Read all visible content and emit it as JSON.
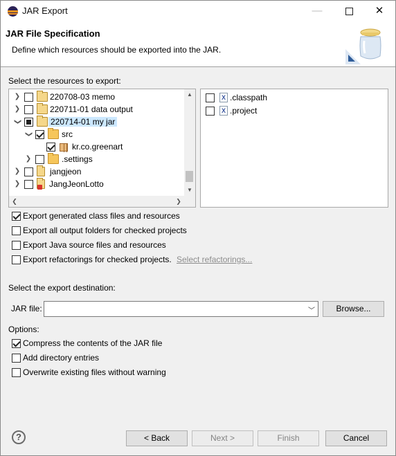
{
  "window": {
    "title": "JAR Export"
  },
  "banner": {
    "title": "JAR File Specification",
    "description": "Define which resources should be exported into the JAR."
  },
  "resources": {
    "label": "Select the resources to export:",
    "tree": [
      {
        "label": "220708-03 memo",
        "checked": false
      },
      {
        "label": "220711-01 data output",
        "checked": false
      },
      {
        "label": "220714-01 my jar",
        "checked": "partial",
        "selected": true
      },
      {
        "label": "src",
        "checked": true
      },
      {
        "label": "kr.co.greenart",
        "checked": true
      },
      {
        "label": ".settings",
        "checked": false
      },
      {
        "label": "jangjeon",
        "checked": false
      },
      {
        "label": "JangJeonLotto",
        "checked": false
      }
    ],
    "files": [
      {
        "label": ".classpath",
        "checked": false
      },
      {
        "label": ".project",
        "checked": false
      }
    ]
  },
  "options_top": [
    {
      "label": "Export generated class files and resources",
      "checked": true
    },
    {
      "label": "Export all output folders for checked projects",
      "checked": false
    },
    {
      "label": "Export Java source files and resources",
      "checked": false
    },
    {
      "label": "Export refactorings for checked projects.",
      "checked": false
    }
  ],
  "refactor_link": "Select refactorings...",
  "destination": {
    "label": "Select the export destination:",
    "jar_label": "JAR file:",
    "jar_value": "",
    "browse": "Browse..."
  },
  "options": {
    "label": "Options:",
    "items": [
      {
        "label": "Compress the contents of the JAR file",
        "checked": true
      },
      {
        "label": "Add directory entries",
        "checked": false
      },
      {
        "label": "Overwrite existing files without warning",
        "checked": false
      }
    ]
  },
  "buttons": {
    "help": "?",
    "back": "< Back",
    "next": "Next >",
    "finish": "Finish",
    "cancel": "Cancel"
  }
}
